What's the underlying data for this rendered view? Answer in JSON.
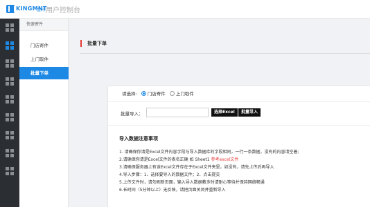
{
  "header": {
    "brand": "KINGMNT",
    "brand_sub": "金码",
    "title": "用户控制台",
    "accent": "#1e88e5"
  },
  "rail": {
    "items": [
      {
        "icon": "grid-icon",
        "active": false
      },
      {
        "icon": "grid-icon",
        "active": true
      },
      {
        "icon": "grid-icon",
        "active": false
      },
      {
        "icon": "grid-icon",
        "active": false
      },
      {
        "icon": "grid-icon",
        "active": false
      },
      {
        "icon": "grid-icon",
        "active": false
      },
      {
        "icon": "grid-icon",
        "active": false
      },
      {
        "icon": "grid-icon",
        "active": false
      },
      {
        "icon": "grid-icon",
        "active": false
      }
    ]
  },
  "sidebar": {
    "title": "快速寄件",
    "items": [
      {
        "label": "门店寄件"
      },
      {
        "label": "上门取件"
      },
      {
        "label": "批量下单",
        "active": true
      }
    ]
  },
  "breadcrumb": {
    "label": "批量下单",
    "marker_color": "#e53935"
  },
  "form": {
    "select_label": "请选择:",
    "options": [
      {
        "label": "门店寄件",
        "checked": true
      },
      {
        "label": "上门取件",
        "checked": false
      }
    ],
    "import_label": "批量导入：",
    "file_value": "",
    "select_excel_button": "选择Excel",
    "bulk_import_button": "批量导入"
  },
  "notes": {
    "title": "导入数据注意事项",
    "line1": "1. 请确保你请是Excel文件内容字段与导入数据库的字段相同，一行一条数据，没有的内容请空着;",
    "line2_prefix": "2.请确保你请是Excel文件的表名正确 如 Sheet1 ",
    "line2_link": "参考excel文件",
    "line3": "3.请确保服务器上有该Excel文件存在于Excel文件夹里，如没有，请先上传后再导入",
    "line4": "4.导入步骤：1、选择要导入的数据文件；2、点击提交",
    "line5": "5.上传文件时，请勿刷新页面，输入导入数据教多时请耐心等待并保持网络畅通",
    "line6": "6.长时间（5分钟以上）无反映，请把页面关闭并重新导入",
    "link_color": "#e53935"
  }
}
